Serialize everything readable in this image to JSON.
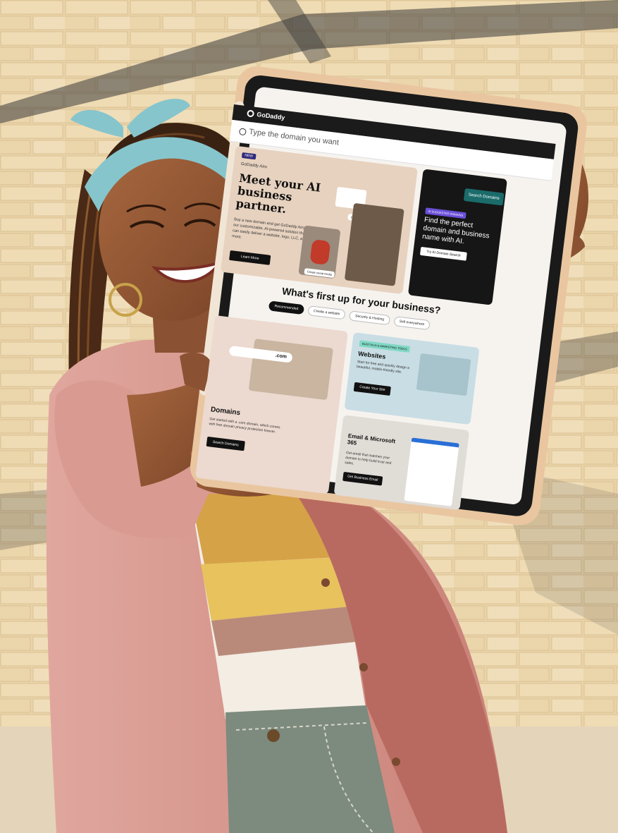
{
  "scene": {
    "description_colors": {
      "wall": "#e9d2a6",
      "shirt": "#d99a92",
      "headband": "#86c5cc",
      "tablet_case": "#e6c19a",
      "screen_bg": "#f6f3ef",
      "accent_teal": "#1b6b6b"
    }
  },
  "tablet_screen": {
    "brand": "GoDaddy",
    "search": {
      "placeholder": "Type the domain you want",
      "button_label": "Search Domains"
    },
    "hero": {
      "badge": "NEW",
      "product": "GoDaddy Airo",
      "title": "Meet your AI business partner.",
      "body": "Buy a new domain and get GoDaddy Airo™, our customizable, AI-powered solution that can easily deliver a website, logo, LLC, and more.",
      "button_label": "Learn More",
      "chip_generate": "Generate logo",
      "chip_create": "Create social media"
    },
    "ai_panel": {
      "badge": "AI SUGGESTED DOMAINS",
      "title": "Find the perfect domain and business name with AI.",
      "button_label": "Try AI Domain Search"
    },
    "section_title": "What's first up for your business?",
    "pills": [
      {
        "label": "Recommended",
        "active": true
      },
      {
        "label": "Create a website",
        "active": false
      },
      {
        "label": "Security & Hosting",
        "active": false
      },
      {
        "label": "Sell everywhere",
        "active": false
      }
    ],
    "domains_card": {
      "pill_text": ".com",
      "title": "Domains",
      "body": "Get started with a .com domain, which comes with free domain privacy protection forever.",
      "button_label": "Search Domains"
    },
    "websites_card": {
      "badge": "BUILT-IN AI & MARKETING TOOLS",
      "title": "Websites",
      "body": "Start for free and quickly design a beautiful, mobile-friendly site.",
      "button_label": "Create Your Site"
    },
    "email_card": {
      "title": "Email & Microsoft 365",
      "body": "Get email that matches your domain to help build trust and sales.",
      "button_label": "Get Business Email"
    }
  }
}
